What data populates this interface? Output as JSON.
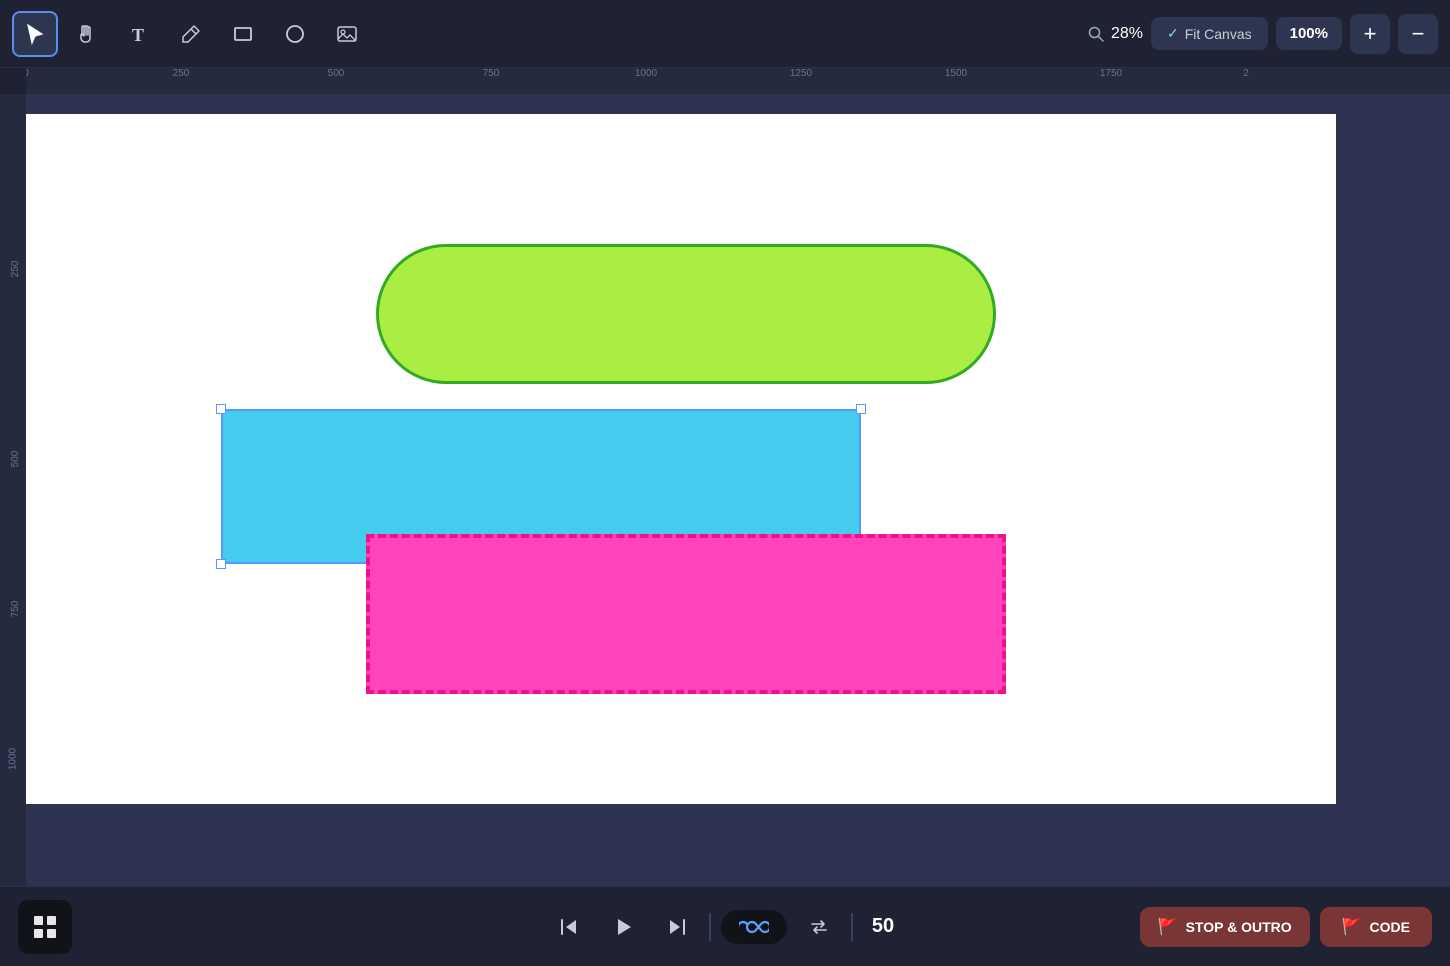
{
  "toolbar": {
    "tools": [
      {
        "id": "select",
        "label": "Select Tool",
        "icon": "▲",
        "active": true
      },
      {
        "id": "hand",
        "label": "Hand Tool",
        "icon": "✋",
        "active": false
      },
      {
        "id": "text",
        "label": "Text Tool",
        "icon": "T",
        "active": false
      },
      {
        "id": "pen",
        "label": "Pen Tool",
        "icon": "🔧",
        "active": false
      },
      {
        "id": "rect",
        "label": "Rectangle Tool",
        "icon": "□",
        "active": false
      },
      {
        "id": "ellipse",
        "label": "Ellipse Tool",
        "icon": "○",
        "active": false
      },
      {
        "id": "image",
        "label": "Image Tool",
        "icon": "🖼",
        "active": false
      }
    ],
    "zoom_value": "28%",
    "fit_canvas_label": "Fit Canvas",
    "zoom_percent": "100%",
    "zoom_plus": "+",
    "zoom_minus": "−"
  },
  "ruler": {
    "h_ticks": [
      "0",
      "250",
      "500",
      "750",
      "1000",
      "1250",
      "1500",
      "1750",
      "2"
    ],
    "v_ticks": [
      "250",
      "500",
      "750",
      "1000"
    ]
  },
  "canvas": {
    "shapes": [
      {
        "id": "green-pill",
        "color": "#aaee44",
        "border_color": "#33aa22",
        "type": "pill"
      },
      {
        "id": "cyan-rect",
        "color": "#44ccee",
        "type": "rect",
        "selected": true
      },
      {
        "id": "pink-rect",
        "color": "#ff44bb",
        "type": "rect",
        "dashed": true
      }
    ]
  },
  "bottom_bar": {
    "frame_count": "50",
    "stop_outro_label": "STOP & OUTRO",
    "code_label": "CODE",
    "flag_icon": "🚩"
  }
}
